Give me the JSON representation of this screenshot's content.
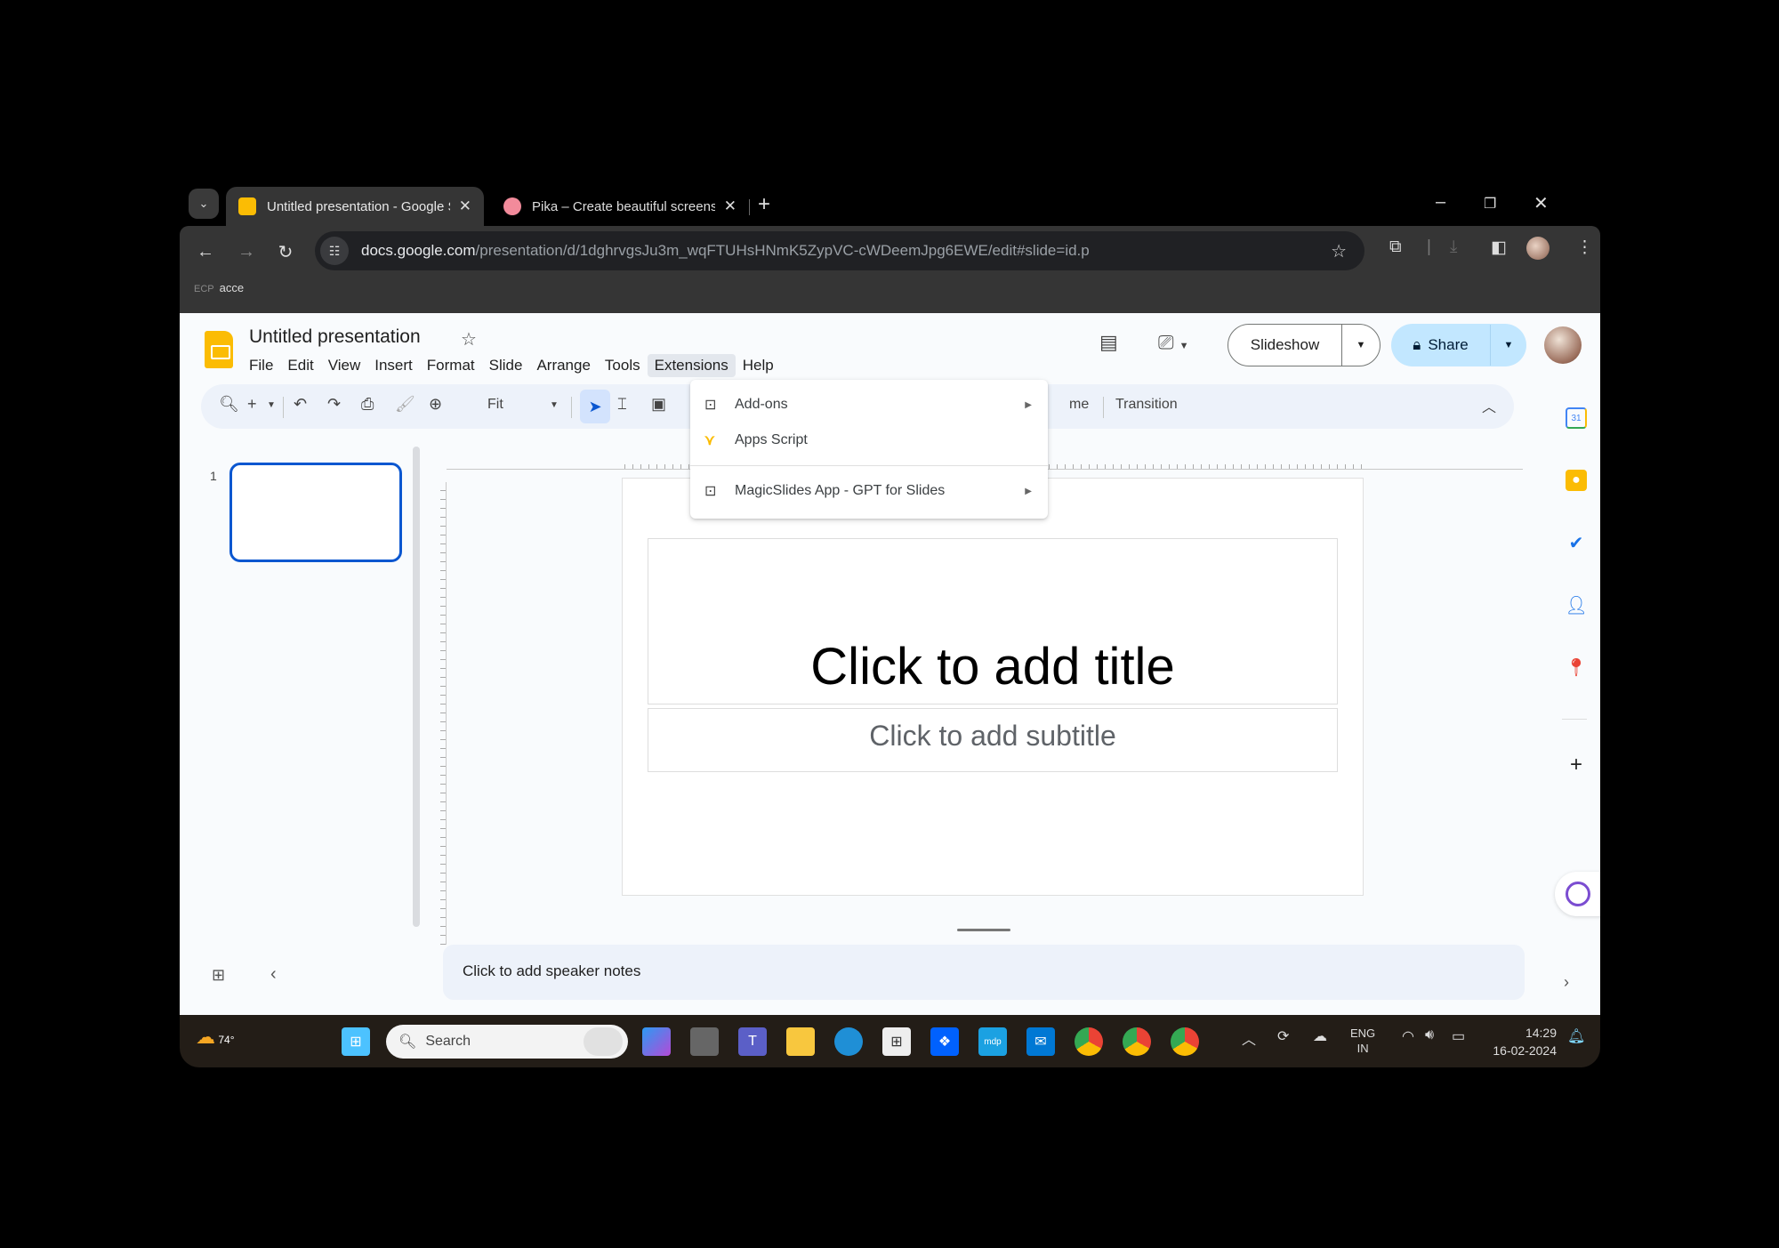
{
  "browser": {
    "tabs": [
      {
        "title": "Untitled presentation - Google Slides",
        "active": true,
        "favicon_color": "#fbbc04"
      },
      {
        "title": "Pika – Create beautiful screenshots",
        "active": false,
        "favicon_color": "#f28b9b"
      }
    ],
    "tab_close_glyph": "✕",
    "new_tab_glyph": "+",
    "tab_search_glyph": "⌄",
    "window_controls": {
      "minimize": "–",
      "restore": "❐",
      "close": "✕"
    },
    "url_domain": "docs.google.com",
    "url_path": "/presentation/d/1dghrvgsJu3m_wqFTUHsHNmK5ZypVC-cWDeemJpg6EWE/edit#slide=id.p",
    "bookmark": {
      "icon_text": "ECP",
      "label": "acce"
    }
  },
  "app": {
    "doc_title": "Untitled presentation",
    "menus": [
      "File",
      "Edit",
      "View",
      "Insert",
      "Format",
      "Slide",
      "Arrange",
      "Tools",
      "Extensions",
      "Help"
    ],
    "open_menu": "Extensions",
    "slideshow_label": "Slideshow",
    "share_label": "Share",
    "toolbar": {
      "zoom_value": "Fit",
      "partial_label": "me",
      "transition_label": "Transition"
    },
    "extensions_menu": [
      {
        "label": "Add-ons",
        "icon": "addon-icon",
        "submenu": true
      },
      {
        "label": "Apps Script",
        "icon": "apps-script-icon",
        "submenu": false
      },
      {
        "label": "MagicSlides App - GPT for Slides",
        "icon": "addon-icon",
        "submenu": true
      }
    ],
    "slide_number": "1",
    "slide": {
      "title_placeholder": "Click to add title",
      "subtitle_placeholder": "Click to add subtitle"
    },
    "speaker_notes_placeholder": "Click to add speaker notes",
    "side_panel": [
      "calendar-icon",
      "keep-icon",
      "tasks-icon",
      "contacts-icon",
      "maps-icon",
      "add-icon"
    ]
  },
  "taskbar": {
    "weather": "74°",
    "search_placeholder": "Search",
    "language": [
      "ENG",
      "IN"
    ],
    "time": "14:29",
    "date": "16-02-2024"
  }
}
